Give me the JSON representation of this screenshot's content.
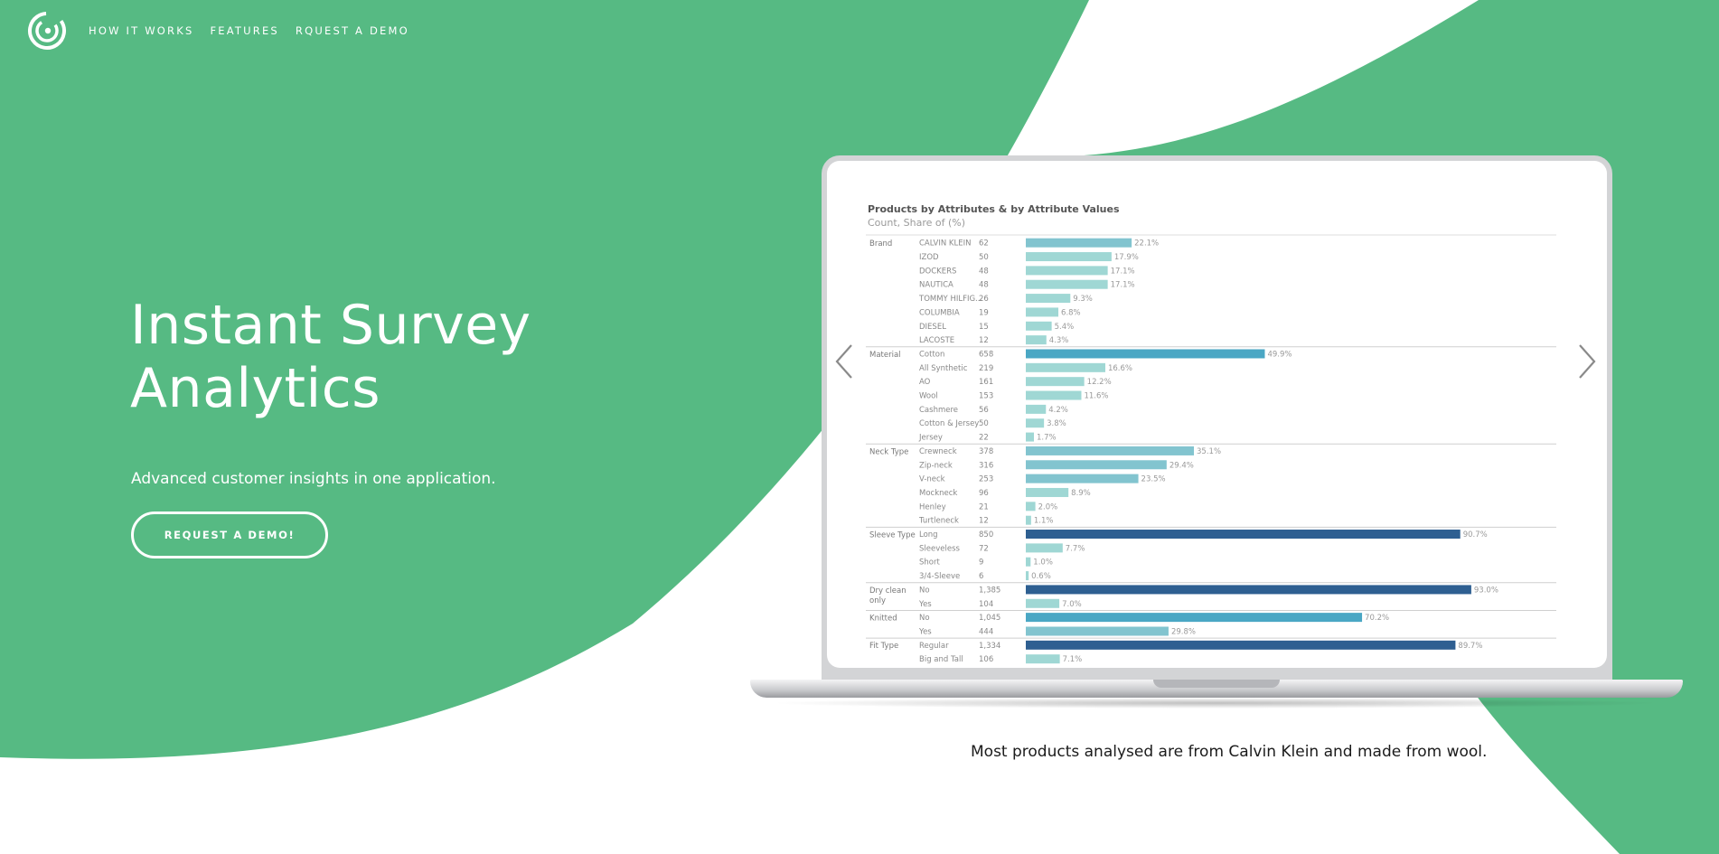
{
  "colors": {
    "brand_green": "#56ba83",
    "white": "#ffffff",
    "bar_light": "#9fd7d4",
    "bar_mid": "#4aa7c4",
    "bar_dark": "#2e5f91"
  },
  "nav": {
    "logo_icon": "brand-logo-icon",
    "links": [
      "HOW IT WORKS",
      "FEATURES",
      "RQUEST A DEMO"
    ]
  },
  "hero": {
    "title_line1": "Instant Survey",
    "title_line2": "Analytics",
    "subtitle": "Advanced customer insights in one application.",
    "cta_label": "REQUEST A DEMO!"
  },
  "carousel": {
    "prev_icon": "chevron-left-icon",
    "next_icon": "chevron-right-icon",
    "caption": "Most products analysed are from Calvin Klein and made from wool."
  },
  "chart_data": {
    "type": "bar",
    "title": "Products by Attributes & by Attribute Values",
    "subtitle": "Count, Share of (%)",
    "groups": [
      {
        "name": "Brand",
        "rows": [
          {
            "label": "CALVIN KLEIN",
            "count": "62",
            "share": 22.1,
            "share_label": "22.1%"
          },
          {
            "label": "IZOD",
            "count": "50",
            "share": 17.9,
            "share_label": "17.9%"
          },
          {
            "label": "DOCKERS",
            "count": "48",
            "share": 17.1,
            "share_label": "17.1%"
          },
          {
            "label": "NAUTICA",
            "count": "48",
            "share": 17.1,
            "share_label": "17.1%"
          },
          {
            "label": "TOMMY HILFIG...",
            "count": "26",
            "share": 9.3,
            "share_label": "9.3%"
          },
          {
            "label": "COLUMBIA",
            "count": "19",
            "share": 6.8,
            "share_label": "6.8%"
          },
          {
            "label": "DIESEL",
            "count": "15",
            "share": 5.4,
            "share_label": "5.4%"
          },
          {
            "label": "LACOSTE",
            "count": "12",
            "share": 4.3,
            "share_label": "4.3%"
          }
        ]
      },
      {
        "name": "Material",
        "rows": [
          {
            "label": "Cotton",
            "count": "658",
            "share": 49.9,
            "share_label": "49.9%"
          },
          {
            "label": "All Synthetic",
            "count": "219",
            "share": 16.6,
            "share_label": "16.6%"
          },
          {
            "label": "AO",
            "count": "161",
            "share": 12.2,
            "share_label": "12.2%"
          },
          {
            "label": "Wool",
            "count": "153",
            "share": 11.6,
            "share_label": "11.6%"
          },
          {
            "label": "Cashmere",
            "count": "56",
            "share": 4.2,
            "share_label": "4.2%"
          },
          {
            "label": "Cotton & Jersey",
            "count": "50",
            "share": 3.8,
            "share_label": "3.8%"
          },
          {
            "label": "Jersey",
            "count": "22",
            "share": 1.7,
            "share_label": "1.7%"
          }
        ]
      },
      {
        "name": "Neck Type",
        "rows": [
          {
            "label": "Crewneck",
            "count": "378",
            "share": 35.1,
            "share_label": "35.1%"
          },
          {
            "label": "Zip-neck",
            "count": "316",
            "share": 29.4,
            "share_label": "29.4%"
          },
          {
            "label": "V-neck",
            "count": "253",
            "share": 23.5,
            "share_label": "23.5%"
          },
          {
            "label": "Mockneck",
            "count": "96",
            "share": 8.9,
            "share_label": "8.9%"
          },
          {
            "label": "Henley",
            "count": "21",
            "share": 2.0,
            "share_label": "2.0%"
          },
          {
            "label": "Turtleneck",
            "count": "12",
            "share": 1.1,
            "share_label": "1.1%"
          }
        ]
      },
      {
        "name": "Sleeve Type",
        "rows": [
          {
            "label": "Long",
            "count": "850",
            "share": 90.7,
            "share_label": "90.7%"
          },
          {
            "label": "Sleeveless",
            "count": "72",
            "share": 7.7,
            "share_label": "7.7%"
          },
          {
            "label": "Short",
            "count": "9",
            "share": 1.0,
            "share_label": "1.0%"
          },
          {
            "label": "3/4-Sleeve",
            "count": "6",
            "share": 0.6,
            "share_label": "0.6%"
          }
        ]
      },
      {
        "name": "Dry clean only",
        "rows": [
          {
            "label": "No",
            "count": "1,385",
            "share": 93.0,
            "share_label": "93.0%"
          },
          {
            "label": "Yes",
            "count": "104",
            "share": 7.0,
            "share_label": "7.0%"
          }
        ]
      },
      {
        "name": "Knitted",
        "rows": [
          {
            "label": "No",
            "count": "1,045",
            "share": 70.2,
            "share_label": "70.2%"
          },
          {
            "label": "Yes",
            "count": "444",
            "share": 29.8,
            "share_label": "29.8%"
          }
        ]
      },
      {
        "name": "Fit Type",
        "rows": [
          {
            "label": "Regular",
            "count": "1,334",
            "share": 89.7,
            "share_label": "89.7%"
          },
          {
            "label": "Big and Tall",
            "count": "106",
            "share": 7.1,
            "share_label": "7.1%"
          }
        ]
      }
    ],
    "xlim": [
      0,
      100
    ],
    "grid": false
  }
}
